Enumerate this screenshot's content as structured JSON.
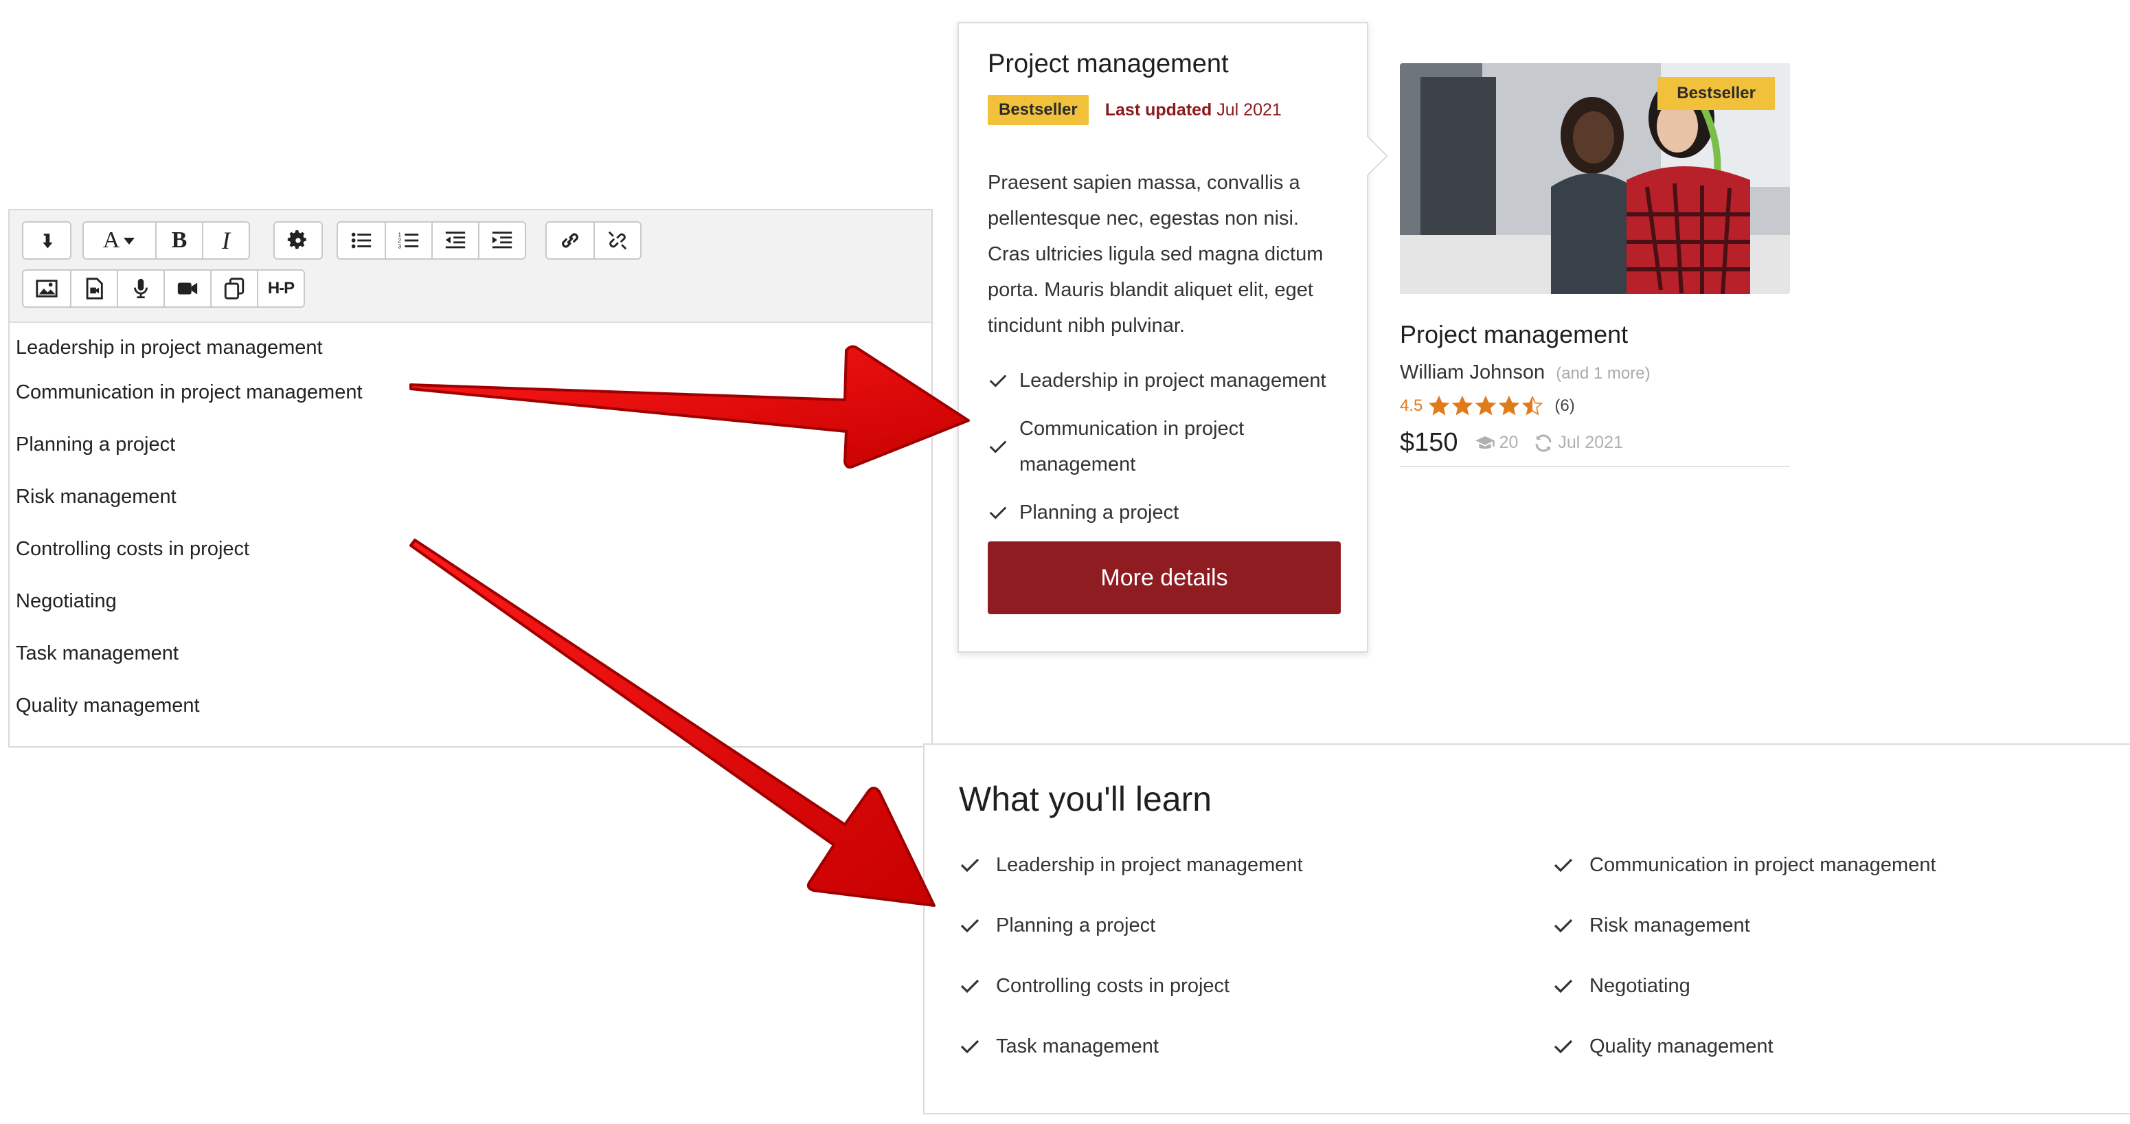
{
  "editor": {
    "toolbar": {
      "rows": [
        [
          {
            "icon": "collapse-icon",
            "group": 1
          },
          {
            "icon": "font-icon",
            "group": 2
          },
          {
            "icon": "bold-icon",
            "group": 2
          },
          {
            "icon": "italic-icon",
            "group": 2
          },
          {
            "icon": "settings-icon",
            "group": 3
          },
          {
            "icon": "bullet-list-icon",
            "group": 4
          },
          {
            "icon": "numbered-list-icon",
            "group": 4
          },
          {
            "icon": "outdent-icon",
            "group": 4
          },
          {
            "icon": "indent-icon",
            "group": 4
          },
          {
            "icon": "link-icon",
            "group": 5
          },
          {
            "icon": "unlink-icon",
            "group": 5
          }
        ],
        [
          {
            "icon": "image-icon"
          },
          {
            "icon": "media-file-icon"
          },
          {
            "icon": "microphone-icon"
          },
          {
            "icon": "video-icon"
          },
          {
            "icon": "copy-icon"
          },
          {
            "icon": "h5p-icon",
            "label": "H-P"
          }
        ]
      ]
    },
    "lines": [
      "Leadership in project management",
      "Communication in project management",
      "Planning a project",
      "Risk management",
      "Controlling costs in project",
      "Negotiating",
      "Task management",
      "Quality management"
    ]
  },
  "popover": {
    "title": "Project management",
    "badge": "Bestseller",
    "last_updated_label": "Last updated",
    "last_updated_value": "Jul 2021",
    "description": "Praesent sapien massa, convallis a pellentesque nec, egestas non nisi. Cras ultricies ligula sed magna dictum porta. Mauris blandit aliquet elit, eget tincidunt nibh pulvinar.",
    "checks": [
      "Leadership in project management",
      "Communication in project management",
      "Planning a project"
    ],
    "button_label": "More details",
    "button_color": "#8f1c21"
  },
  "course_card": {
    "image_badge": "Bestseller",
    "title": "Project management",
    "author": "William Johnson",
    "author_more": "(and 1 more)",
    "rating": "4.5",
    "rating_value": 4.5,
    "rating_count": "(6)",
    "price": "$150",
    "students": "20",
    "updated": "Jul 2021",
    "star_color": "#e07b1c"
  },
  "learn": {
    "title": "What you'll learn",
    "items": [
      "Leadership in project management",
      "Communication in project management",
      "Planning a project",
      "Risk management",
      "Controlling costs in project",
      "Negotiating",
      "Task management",
      "Quality management"
    ]
  },
  "colors": {
    "accent": "#8f1c21",
    "badge": "#f2c13c",
    "arrow": "#e00000"
  }
}
